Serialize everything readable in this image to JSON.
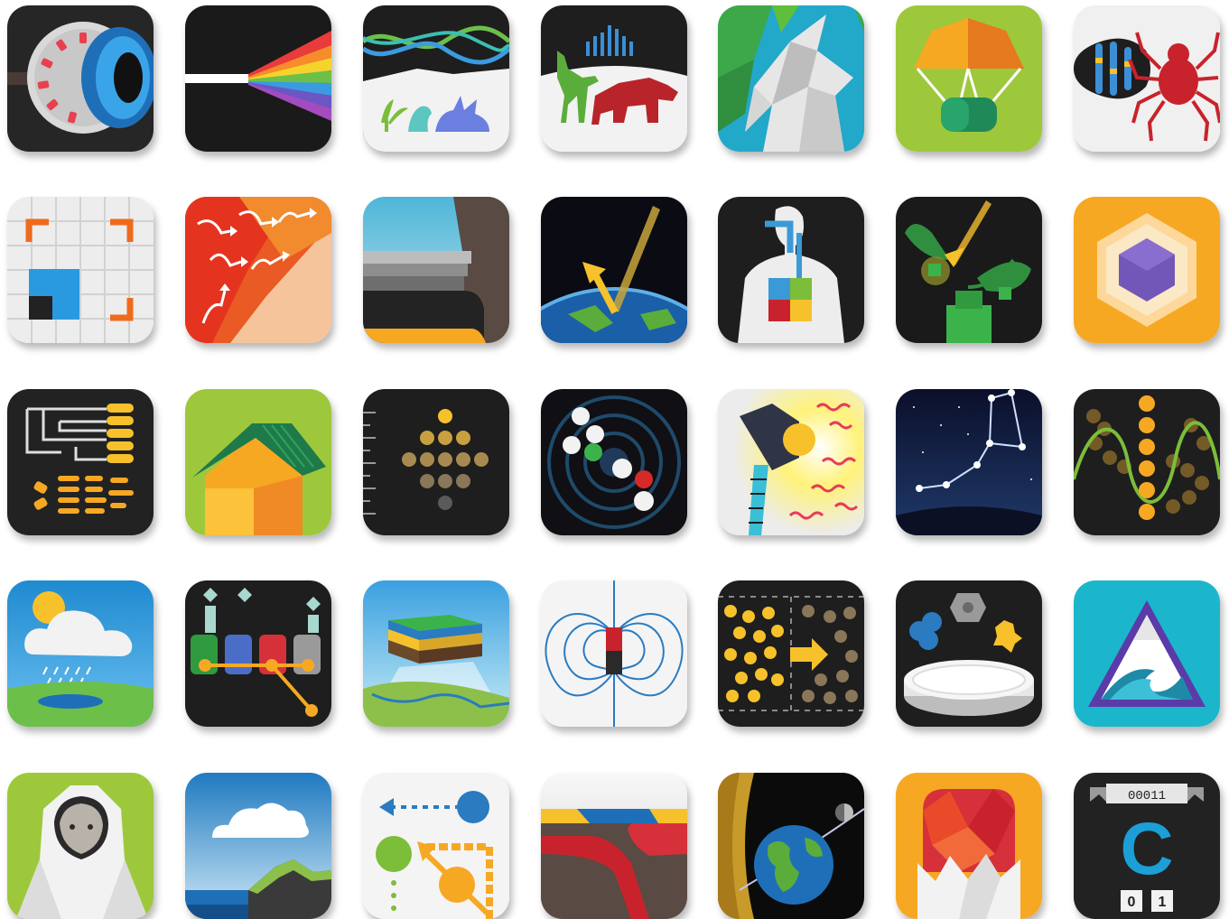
{
  "icons": [
    {
      "icon": "eye-icon"
    },
    {
      "icon": "prism-rainbow-icon"
    },
    {
      "icon": "natural-selection-icon"
    },
    {
      "icon": "fossil-record-icon"
    },
    {
      "icon": "origami-unicorn-icon"
    },
    {
      "icon": "parachute-supply-icon"
    },
    {
      "icon": "chromosome-spider-icon"
    },
    {
      "icon": "grid-selection-icon"
    },
    {
      "icon": "heat-flow-icon"
    },
    {
      "icon": "glacier-valley-icon"
    },
    {
      "icon": "earth-radiation-icon"
    },
    {
      "icon": "human-body-organs-icon"
    },
    {
      "icon": "plant-blocks-icon"
    },
    {
      "icon": "hexagon-crystal-icon"
    },
    {
      "icon": "phylogenetic-tree-icon"
    },
    {
      "icon": "house-icon"
    },
    {
      "icon": "dot-diamond-scale-icon"
    },
    {
      "icon": "molecule-orbit-icon"
    },
    {
      "icon": "lamp-heat-icon"
    },
    {
      "icon": "constellation-icon"
    },
    {
      "icon": "wave-particles-icon"
    },
    {
      "icon": "rain-cloud-icon"
    },
    {
      "icon": "code-blocks-icon"
    },
    {
      "icon": "rock-layers-icon"
    },
    {
      "icon": "magnet-field-icon"
    },
    {
      "icon": "particle-diffusion-icon"
    },
    {
      "icon": "petri-dish-icon"
    },
    {
      "icon": "mountain-wave-icon"
    },
    {
      "icon": "astronaut-icon"
    },
    {
      "icon": "coastal-landscape-icon"
    },
    {
      "icon": "vector-motion-icon"
    },
    {
      "icon": "tectonic-plates-icon"
    },
    {
      "icon": "earth-moon-orbit-icon"
    },
    {
      "icon": "eggshell-crack-icon"
    },
    {
      "icon": "binary-counter-icon"
    }
  ],
  "binary_counter": {
    "register": "00011",
    "letter": "C",
    "bit_left": "0",
    "bit_right": "1"
  },
  "colors": {
    "dark_tile": "#222222",
    "lime": "#9dc83c",
    "orange": "#f7a823",
    "teal": "#1bb6cc",
    "sky": "#2f8bcf"
  }
}
